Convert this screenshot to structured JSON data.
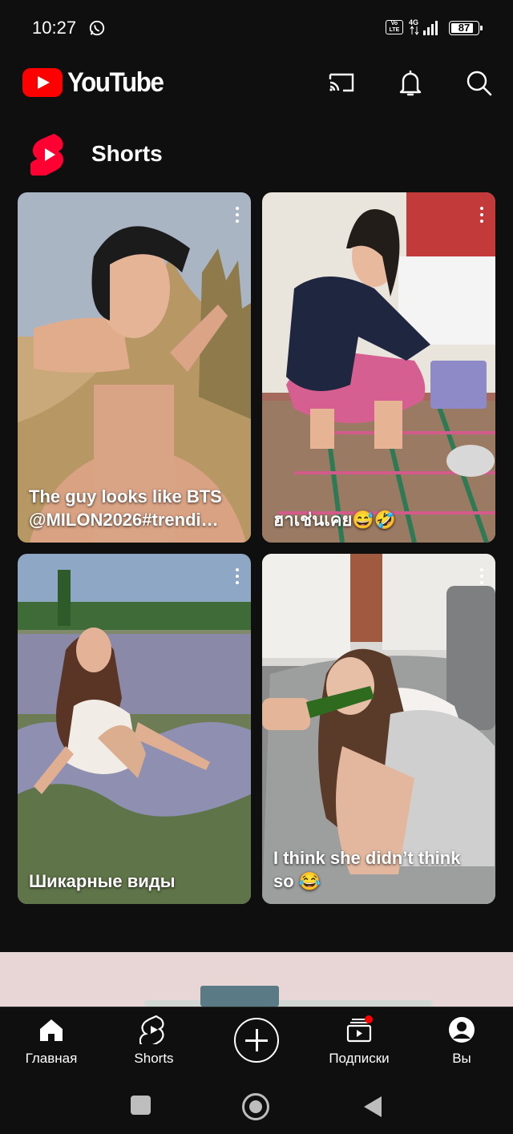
{
  "status_bar": {
    "time": "10:27",
    "volte": "Vo LTE",
    "network": "4G",
    "battery": "87",
    "icons": [
      "whatsapp-icon",
      "volte-icon",
      "signal-icon",
      "battery-icon"
    ]
  },
  "header": {
    "brand": "YouTube",
    "brand_color": "#ff0000",
    "icons": [
      "cast-icon",
      "notifications-bell-icon",
      "search-icon"
    ]
  },
  "shorts": {
    "title": "Shorts",
    "items": [
      {
        "caption": "The guy looks like BTS\n@MILON2026#trendi…"
      },
      {
        "caption": "ฮาเช่นเคย😅🤣"
      },
      {
        "caption": "Шикарные виды"
      },
      {
        "caption": "I think she didn’t think\nso 😂"
      }
    ]
  },
  "bottom_nav": {
    "items": [
      {
        "label": "Главная",
        "icon": "home-icon"
      },
      {
        "label": "Shorts",
        "icon": "shorts-icon"
      },
      {
        "label": "",
        "icon": "create-plus-icon"
      },
      {
        "label": "Подписки",
        "icon": "subscriptions-icon"
      },
      {
        "label": "Вы",
        "icon": "account-icon"
      }
    ]
  },
  "system_nav": [
    "recents-button",
    "home-button",
    "back-button"
  ]
}
